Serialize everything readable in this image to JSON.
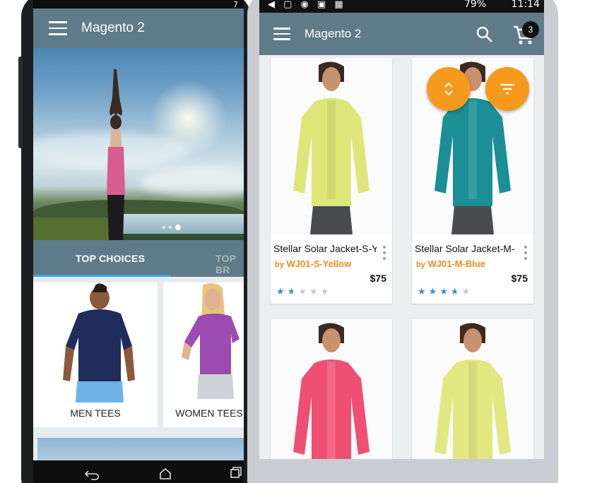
{
  "left_phone": {
    "app_title": "Magento 2",
    "status_text": "7",
    "banner_dots": [
      false,
      false,
      true
    ],
    "tabs": [
      "TOP CHOICES",
      "TOP BR"
    ],
    "categories": [
      "MEN TEES",
      "WOMEN TEES"
    ]
  },
  "right_phone": {
    "status": {
      "icons": "◀ ▢ ◉ ▣ ▦",
      "battery": "79%",
      "time": "11:14"
    },
    "app_title": "Magento 2",
    "cart_count": "3",
    "icons": {
      "search": "search-icon",
      "cart": "cart-icon",
      "sort": "sort-icon",
      "filter": "filter-icon"
    },
    "colors": {
      "app_bar": "#5f7a89",
      "accent_orange": "#f69a1d",
      "sku_orange": "#f28b1b",
      "star_blue": "#2d8fd6",
      "tab_indicator": "#3aa3e3"
    },
    "products": [
      {
        "name": "Stellar Solar Jacket-S-Y",
        "by": "by",
        "sku": "WJ01-S-Yellow",
        "price": "$75",
        "rating": 1.5,
        "color": "#dfe679"
      },
      {
        "name": "Stellar Solar Jacket-M-",
        "by": "by",
        "sku": "WJ01-M-Blue",
        "price": "$75",
        "rating": 3.5,
        "color": "#1b8f95"
      },
      {
        "color": "#ef4f72"
      },
      {
        "color": "#e2e881"
      }
    ]
  }
}
